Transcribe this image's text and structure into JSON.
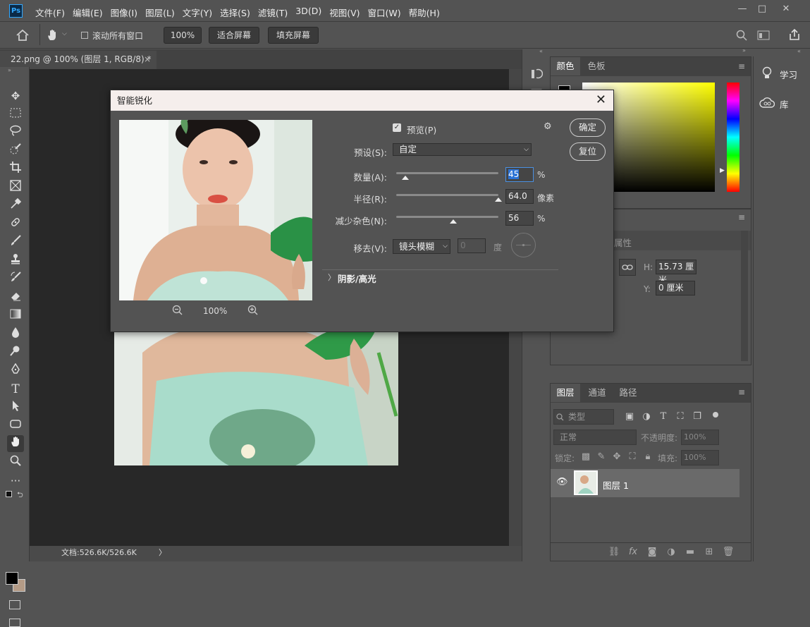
{
  "app": {
    "logo": "Ps"
  },
  "menu": [
    "文件(F)",
    "编辑(E)",
    "图像(I)",
    "图层(L)",
    "文字(Y)",
    "选择(S)",
    "滤镜(T)",
    "3D(D)",
    "视图(V)",
    "窗口(W)",
    "帮助(H)"
  ],
  "window_controls": {
    "minimize": "—",
    "maximize": "□",
    "close": "✕"
  },
  "options": {
    "scroll_all": "滚动所有窗口",
    "zoom": "100%",
    "fit_screen": "适合屏幕",
    "fill_screen": "填充屏幕"
  },
  "doc_tab": {
    "title": "22.png @ 100% (图层 1, RGB/8) *",
    "close": "×"
  },
  "status": {
    "doc": "文档:526.6K/526.6K",
    "arrow": "〉"
  },
  "color_panel": {
    "tabs": [
      "颜色",
      "色板"
    ]
  },
  "side_buttons": {
    "learn": "学习",
    "library": "库"
  },
  "properties_panel": {
    "title": "属性",
    "h_label": "H:",
    "h_value": "15.73 厘米",
    "y_label": "Y:",
    "y_value": "0 厘米"
  },
  "layers_panel": {
    "tabs": [
      "图层",
      "通道",
      "路径"
    ],
    "filter": "类型",
    "blend_mode": "正常",
    "opacity_label": "不透明度:",
    "opacity_value": "100%",
    "lock_label": "锁定:",
    "fill_label": "填充:",
    "fill_value": "100%",
    "layer_name": "图层 1"
  },
  "dialog": {
    "title": "智能锐化",
    "close": "✕",
    "preview_label": "预览(P)",
    "preview_checked": true,
    "preset_label": "预设(S):",
    "preset_value": "自定",
    "amount_label": "数量(A):",
    "amount_value": "45",
    "amount_unit": "%",
    "amount_fraction": 0.09,
    "radius_label": "半径(R):",
    "radius_value": "64.0",
    "radius_unit": "像素",
    "radius_fraction": 1.0,
    "noise_label": "减少杂色(N):",
    "noise_value": "56",
    "noise_unit": "%",
    "noise_fraction": 0.56,
    "remove_label": "移去(V):",
    "remove_value": "镜头模糊",
    "angle_value": "0",
    "angle_unit": "度",
    "shadow_label": "阴影/高光",
    "ok": "确定",
    "reset": "复位",
    "zoom": "100%"
  }
}
